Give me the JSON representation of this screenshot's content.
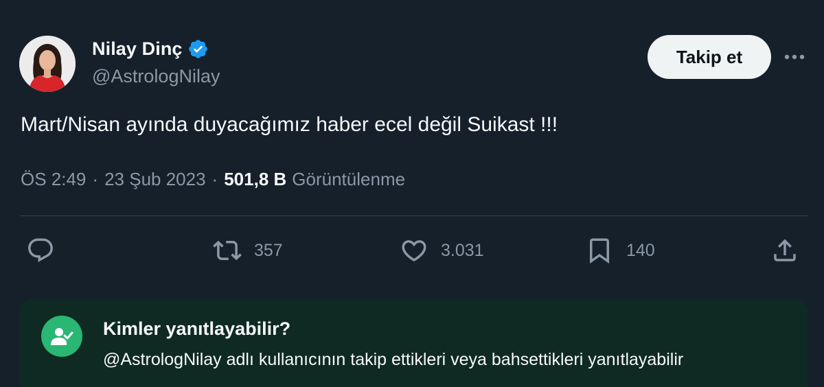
{
  "author": {
    "display_name": "Nilay Dinç",
    "handle": "@AstrologNilay",
    "verified_icon": "verified-badge-icon"
  },
  "follow_label": "Takip et",
  "more_icon": "more-options-icon",
  "tweet": {
    "text": "Mart/Nisan ayında duyacağımız haber ecel değil Suikast !!!",
    "time": "ÖS 2:49",
    "date": "23 Şub 2023",
    "separator": "·",
    "views_count": "501,8 B",
    "views_label": "Görüntülenme"
  },
  "actions": {
    "reply_icon": "reply-icon",
    "retweet_icon": "retweet-icon",
    "retweet_count": "357",
    "like_icon": "heart-icon",
    "like_count": "3.031",
    "bookmark_icon": "bookmark-icon",
    "bookmark_count": "140",
    "share_icon": "share-icon"
  },
  "reply_restriction": {
    "icon": "user-check-icon",
    "title": "Kimler yanıtlayabilir?",
    "description": "@AstrologNilay adlı kullanıcının takip ettikleri veya bahsettikleri yanıtlayabilir"
  },
  "colors": {
    "background": "#15202b",
    "primary_text": "#f7f9f9",
    "secondary_text": "#8b98a5",
    "verified_blue": "#1d9bf0",
    "follow_button_bg": "#eff3f4",
    "reply_box_bg": "#0f2a22",
    "reply_icon_green": "#2ab673"
  }
}
